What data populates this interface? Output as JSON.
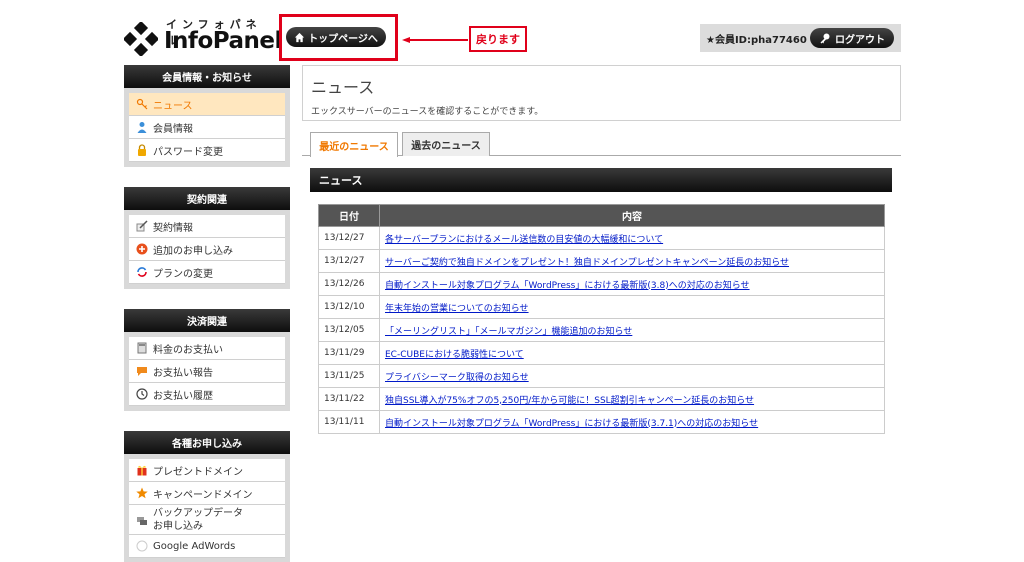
{
  "header": {
    "logo_kana": "インフォパネル",
    "logo_text": "InfoPanel",
    "top_button": "トップページへ",
    "callout": "戻ります",
    "member_id": "★会員ID:pha77460",
    "logout": "ログアウト"
  },
  "sidebar": [
    {
      "title": "会員情報・お知らせ",
      "items": [
        {
          "label": "ニュース",
          "icon": "key-person-icon",
          "active": true
        },
        {
          "label": "会員情報",
          "icon": "person-icon"
        },
        {
          "label": "パスワード変更",
          "icon": "lock-icon"
        }
      ]
    },
    {
      "title": "契約関連",
      "items": [
        {
          "label": "契約情報",
          "icon": "pen-icon"
        },
        {
          "label": "追加のお申し込み",
          "icon": "plus-icon"
        },
        {
          "label": "プランの変更",
          "icon": "refresh-icon"
        }
      ]
    },
    {
      "title": "決済関連",
      "items": [
        {
          "label": "料金のお支払い",
          "icon": "calculator-icon"
        },
        {
          "label": "お支払い報告",
          "icon": "chat-icon"
        },
        {
          "label": "お支払い履歴",
          "icon": "clock-icon"
        }
      ]
    },
    {
      "title": "各種お申し込み",
      "items": [
        {
          "label": "プレゼントドメイン",
          "icon": "gift-icon"
        },
        {
          "label": "キャンペーンドメイン",
          "icon": "star-icon"
        },
        {
          "label": "バックアップデータ",
          "label2": "お申し込み",
          "icon": "backup-icon"
        },
        {
          "label": "Google AdWords",
          "icon": "google-icon"
        }
      ]
    }
  ],
  "main": {
    "title": "ニュース",
    "description": "エックスサーバーのニュースを確認することができます。",
    "tabs": [
      {
        "label": "最近のニュース",
        "active": true
      },
      {
        "label": "過去のニュース"
      }
    ],
    "section_title": "ニュース",
    "table": {
      "headers": [
        "日付",
        "内容"
      ],
      "rows": [
        {
          "date": "13/12/27",
          "text": "各サーバープランにおけるメール送信数の目安値の大幅緩和について"
        },
        {
          "date": "13/12/27",
          "text": "サーバーご契約で独自ドメインをプレゼント！独自ドメインプレゼントキャンペーン延長のお知らせ"
        },
        {
          "date": "13/12/26",
          "text": "自動インストール対象プログラム「WordPress」における最新版(3.8)への対応のお知らせ"
        },
        {
          "date": "13/12/10",
          "text": "年末年始の営業についてのお知らせ"
        },
        {
          "date": "13/12/05",
          "text": "「メーリングリスト」「メールマガジン」機能追加のお知らせ"
        },
        {
          "date": "13/11/29",
          "text": "EC-CUBEにおける脆弱性について"
        },
        {
          "date": "13/11/25",
          "text": "プライバシーマーク取得のお知らせ"
        },
        {
          "date": "13/11/22",
          "text": "独自SSL導入が75%オフの5,250円/年から可能に！SSL超割引キャンペーン延長のお知らせ"
        },
        {
          "date": "13/11/11",
          "text": "自動インストール対象プログラム「WordPress」における最新版(3.7.1)への対応のお知らせ"
        }
      ]
    }
  },
  "colors": {
    "accent": "#f07800",
    "callout": "#e0001a",
    "link": "#0019c8"
  }
}
